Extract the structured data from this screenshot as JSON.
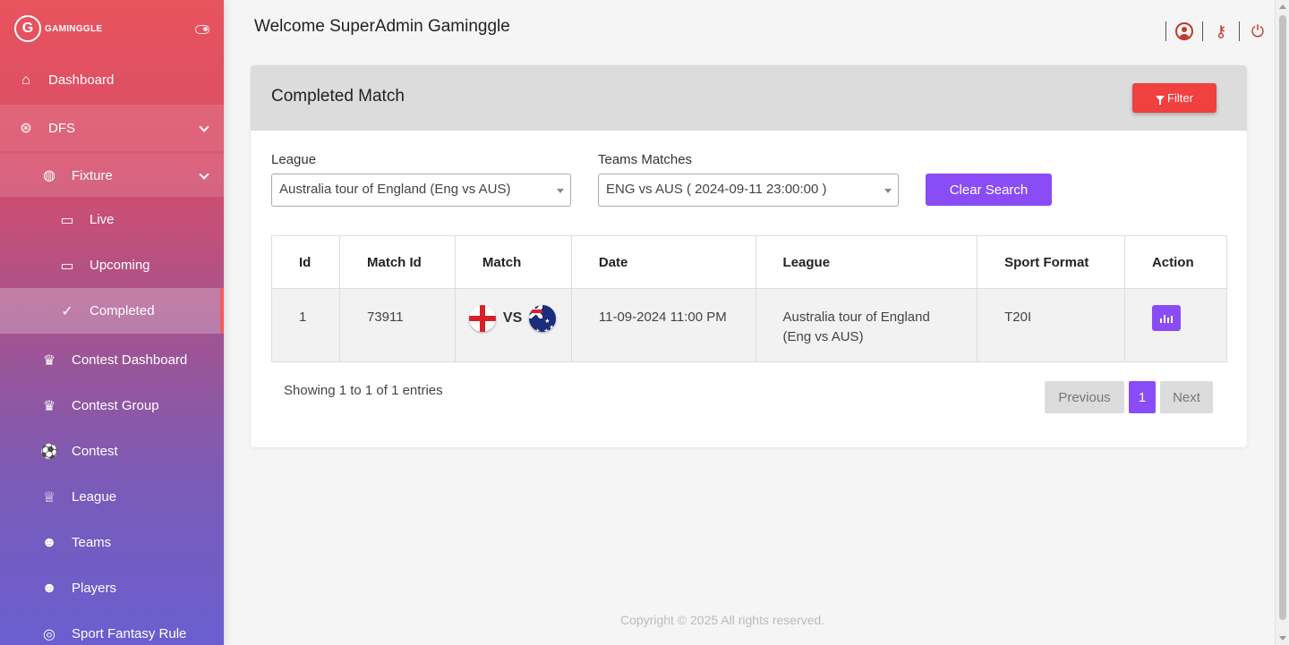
{
  "brand": {
    "logo_letter": "G",
    "name": "GAMINGGLE"
  },
  "sidebar": {
    "items": [
      {
        "label": "Dashboard",
        "icon": "home-icon"
      },
      {
        "label": "DFS",
        "icon": "aperture-icon"
      },
      {
        "label": "Fixture",
        "icon": "globe-icon"
      },
      {
        "label": "Live",
        "icon": "tv-icon"
      },
      {
        "label": "Upcoming",
        "icon": "monitor-icon"
      },
      {
        "label": "Completed",
        "icon": "check-circle-icon"
      },
      {
        "label": "Contest Dashboard",
        "icon": "trophy-icon"
      },
      {
        "label": "Contest Group",
        "icon": "trophy-icon"
      },
      {
        "label": "Contest",
        "icon": "soccer-ball-icon"
      },
      {
        "label": "League",
        "icon": "trophy-outline-icon"
      },
      {
        "label": "Teams",
        "icon": "users-icon"
      },
      {
        "label": "Players",
        "icon": "users-icon"
      },
      {
        "label": "Sport Fantasy Rule",
        "icon": "basketball-icon"
      }
    ]
  },
  "header": {
    "welcome": "Welcome SuperAdmin Gaminggle"
  },
  "card": {
    "title": "Completed Match",
    "filter_label": "Filter",
    "league_label": "League",
    "league_value": "Australia tour of England (Eng vs AUS)",
    "teams_label": "Teams Matches",
    "teams_value": "ENG vs AUS ( 2024-09-11 23:00:00 )",
    "clear_label": "Clear Search"
  },
  "table": {
    "columns": [
      "Id",
      "Match Id",
      "Match",
      "Date",
      "League",
      "Sport Format",
      "Action"
    ],
    "rows": [
      {
        "id": "1",
        "match_id": "73911",
        "vs": "VS",
        "date": "11-09-2024 11:00 PM",
        "league": "Australia tour of England (Eng vs AUS)",
        "format": "T20I"
      }
    ]
  },
  "pagination": {
    "info": "Showing 1 to 1 of 1 entries",
    "previous": "Previous",
    "page": "1",
    "next": "Next"
  },
  "footer": {
    "copyright": "Copyright © 2025  All rights reserved."
  },
  "colors": {
    "accent": "#8a4cf5",
    "filter": "#f04040",
    "icon_red": "#c0392b"
  }
}
